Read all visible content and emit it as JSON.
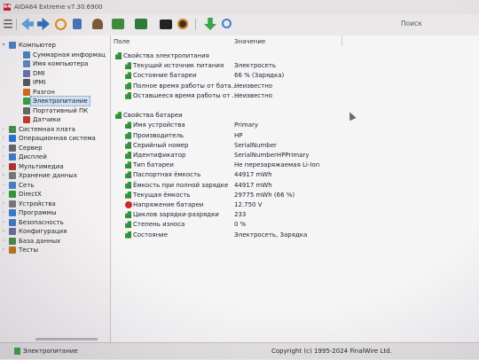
{
  "window": {
    "title": "AIDA64 Extreme v7.30.6900",
    "app_icon_glyph": "64"
  },
  "toolbar": {
    "icons": [
      "menu-icon",
      "back-icon",
      "forward-icon",
      "refresh-icon",
      "report-icon",
      "user-icon",
      "motherboard-icon",
      "osd-icon",
      "benchmark-icon",
      "download-icon",
      "search-icon"
    ],
    "search_placeholder": "Поиск"
  },
  "tree": {
    "items": [
      {
        "label": "Компьютер",
        "level": 0,
        "expanded": true,
        "icon": "computer-icon",
        "color": "#4a7fc0"
      },
      {
        "label": "Суммарная информац",
        "level": 1,
        "icon": "summary-icon",
        "color": "#4a7fc0"
      },
      {
        "label": "Имя компьютера",
        "level": 1,
        "icon": "computer-name-icon",
        "color": "#5b86b8"
      },
      {
        "label": "DMI",
        "level": 1,
        "icon": "dmi-icon",
        "color": "#6a6fa8"
      },
      {
        "label": "IPMI",
        "level": 1,
        "icon": "ipmi-icon",
        "color": "#555"
      },
      {
        "label": "Разгон",
        "level": 1,
        "icon": "overclock-icon",
        "color": "#d06a20"
      },
      {
        "label": "Электропитание",
        "level": 1,
        "icon": "power-icon",
        "color": "#37a041",
        "selected": true
      },
      {
        "label": "Портативный ПК",
        "level": 1,
        "icon": "laptop-icon",
        "color": "#666"
      },
      {
        "label": "Датчики",
        "level": 1,
        "icon": "sensor-icon",
        "color": "#c0392b"
      },
      {
        "label": "Системная плата",
        "level": 0,
        "icon": "motherboard-icon",
        "color": "#4a8a4a"
      },
      {
        "label": "Операционная система",
        "level": 0,
        "icon": "windows-icon",
        "color": "#2b6fd0"
      },
      {
        "label": "Сервер",
        "level": 0,
        "icon": "server-icon",
        "color": "#666"
      },
      {
        "label": "Дисплей",
        "level": 0,
        "icon": "display-icon",
        "color": "#3a7ac8"
      },
      {
        "label": "Мультимедиа",
        "level": 0,
        "icon": "multimedia-icon",
        "color": "#b03030"
      },
      {
        "label": "Хранение данных",
        "level": 0,
        "icon": "storage-icon",
        "color": "#777"
      },
      {
        "label": "Сеть",
        "level": 0,
        "icon": "network-icon",
        "color": "#4a7fc0"
      },
      {
        "label": "DirectX",
        "level": 0,
        "icon": "directx-icon",
        "color": "#2e9a3a"
      },
      {
        "label": "Устройства",
        "level": 0,
        "icon": "devices-icon",
        "color": "#777"
      },
      {
        "label": "Программы",
        "level": 0,
        "icon": "programs-icon",
        "color": "#3a7ac8"
      },
      {
        "label": "Безопасность",
        "level": 0,
        "icon": "security-icon",
        "color": "#3a7ac8"
      },
      {
        "label": "Конфигурация",
        "level": 0,
        "icon": "config-icon",
        "color": "#6a6a9a"
      },
      {
        "label": "База данных",
        "level": 0,
        "icon": "database-icon",
        "color": "#4a8a4a"
      },
      {
        "label": "Тесты",
        "level": 0,
        "icon": "tests-icon",
        "color": "#c07020"
      }
    ]
  },
  "details": {
    "col_field": "Поле",
    "col_value": "Значение",
    "rows": [
      {
        "kind": "section",
        "label": "Свойства электропитания",
        "value": ""
      },
      {
        "kind": "item",
        "icon": "green",
        "label": "Текущий источник питания",
        "value": "Электросеть"
      },
      {
        "kind": "item",
        "icon": "green",
        "label": "Состояние батареи",
        "value": "66 % (Зарядка)"
      },
      {
        "kind": "item",
        "icon": "green",
        "label": "Полное время работы от бата...",
        "value": "Неизвестно"
      },
      {
        "kind": "item",
        "icon": "green",
        "label": "Оставшееся время работы от ...",
        "value": "Неизвестно"
      },
      {
        "kind": "spacer",
        "label": "",
        "value": ""
      },
      {
        "kind": "section",
        "label": "Свойства батареи",
        "value": ""
      },
      {
        "kind": "item",
        "icon": "green",
        "label": "Имя устройства",
        "value": "Primary"
      },
      {
        "kind": "item",
        "icon": "green",
        "label": "Производитель",
        "value": "HP"
      },
      {
        "kind": "item",
        "icon": "green",
        "label": "Серийный номер",
        "value": "SerialNumber"
      },
      {
        "kind": "item",
        "icon": "green",
        "label": "Идентификатор",
        "value": "SerialNumberHPPrimary"
      },
      {
        "kind": "item",
        "icon": "green",
        "label": "Тип батареи",
        "value": "Не перезаряжаемая Li-Ion"
      },
      {
        "kind": "item",
        "icon": "green",
        "label": "Паспортная ёмкость",
        "value": "44917 mWh"
      },
      {
        "kind": "item",
        "icon": "green",
        "label": "Ёмкость при полной зарядке",
        "value": "44917 mWh"
      },
      {
        "kind": "item",
        "icon": "green",
        "label": "Текущая ёмкость",
        "value": "29775 mWh  (66 %)"
      },
      {
        "kind": "item",
        "icon": "warn",
        "label": "Напряжение батареи",
        "value": "12.750 V"
      },
      {
        "kind": "item",
        "icon": "green",
        "label": "Циклов зарядки-разрядки",
        "value": "233"
      },
      {
        "kind": "item",
        "icon": "green",
        "label": "Степень износа",
        "value": "0 %"
      },
      {
        "kind": "item",
        "icon": "green",
        "label": "Состояние",
        "value": "Электросеть, Зарядка"
      }
    ]
  },
  "status": {
    "left_label": "Электропитание",
    "copyright": "Copyright (c) 1995-2024 FinalWire Ltd."
  }
}
